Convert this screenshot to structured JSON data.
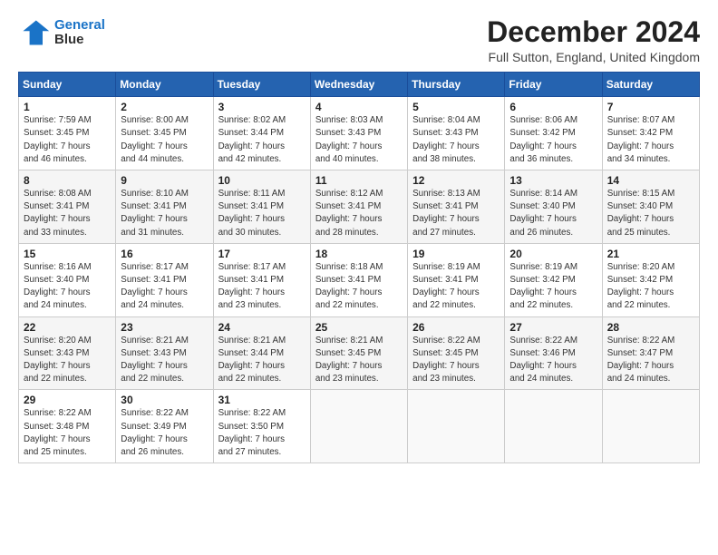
{
  "logo": {
    "line1": "General",
    "line2": "Blue"
  },
  "title": "December 2024",
  "subtitle": "Full Sutton, England, United Kingdom",
  "days_header": [
    "Sunday",
    "Monday",
    "Tuesday",
    "Wednesday",
    "Thursday",
    "Friday",
    "Saturday"
  ],
  "weeks": [
    [
      {
        "num": "1",
        "info": "Sunrise: 7:59 AM\nSunset: 3:45 PM\nDaylight: 7 hours\nand 46 minutes."
      },
      {
        "num": "2",
        "info": "Sunrise: 8:00 AM\nSunset: 3:45 PM\nDaylight: 7 hours\nand 44 minutes."
      },
      {
        "num": "3",
        "info": "Sunrise: 8:02 AM\nSunset: 3:44 PM\nDaylight: 7 hours\nand 42 minutes."
      },
      {
        "num": "4",
        "info": "Sunrise: 8:03 AM\nSunset: 3:43 PM\nDaylight: 7 hours\nand 40 minutes."
      },
      {
        "num": "5",
        "info": "Sunrise: 8:04 AM\nSunset: 3:43 PM\nDaylight: 7 hours\nand 38 minutes."
      },
      {
        "num": "6",
        "info": "Sunrise: 8:06 AM\nSunset: 3:42 PM\nDaylight: 7 hours\nand 36 minutes."
      },
      {
        "num": "7",
        "info": "Sunrise: 8:07 AM\nSunset: 3:42 PM\nDaylight: 7 hours\nand 34 minutes."
      }
    ],
    [
      {
        "num": "8",
        "info": "Sunrise: 8:08 AM\nSunset: 3:41 PM\nDaylight: 7 hours\nand 33 minutes."
      },
      {
        "num": "9",
        "info": "Sunrise: 8:10 AM\nSunset: 3:41 PM\nDaylight: 7 hours\nand 31 minutes."
      },
      {
        "num": "10",
        "info": "Sunrise: 8:11 AM\nSunset: 3:41 PM\nDaylight: 7 hours\nand 30 minutes."
      },
      {
        "num": "11",
        "info": "Sunrise: 8:12 AM\nSunset: 3:41 PM\nDaylight: 7 hours\nand 28 minutes."
      },
      {
        "num": "12",
        "info": "Sunrise: 8:13 AM\nSunset: 3:41 PM\nDaylight: 7 hours\nand 27 minutes."
      },
      {
        "num": "13",
        "info": "Sunrise: 8:14 AM\nSunset: 3:40 PM\nDaylight: 7 hours\nand 26 minutes."
      },
      {
        "num": "14",
        "info": "Sunrise: 8:15 AM\nSunset: 3:40 PM\nDaylight: 7 hours\nand 25 minutes."
      }
    ],
    [
      {
        "num": "15",
        "info": "Sunrise: 8:16 AM\nSunset: 3:40 PM\nDaylight: 7 hours\nand 24 minutes."
      },
      {
        "num": "16",
        "info": "Sunrise: 8:17 AM\nSunset: 3:41 PM\nDaylight: 7 hours\nand 24 minutes."
      },
      {
        "num": "17",
        "info": "Sunrise: 8:17 AM\nSunset: 3:41 PM\nDaylight: 7 hours\nand 23 minutes."
      },
      {
        "num": "18",
        "info": "Sunrise: 8:18 AM\nSunset: 3:41 PM\nDaylight: 7 hours\nand 22 minutes."
      },
      {
        "num": "19",
        "info": "Sunrise: 8:19 AM\nSunset: 3:41 PM\nDaylight: 7 hours\nand 22 minutes."
      },
      {
        "num": "20",
        "info": "Sunrise: 8:19 AM\nSunset: 3:42 PM\nDaylight: 7 hours\nand 22 minutes."
      },
      {
        "num": "21",
        "info": "Sunrise: 8:20 AM\nSunset: 3:42 PM\nDaylight: 7 hours\nand 22 minutes."
      }
    ],
    [
      {
        "num": "22",
        "info": "Sunrise: 8:20 AM\nSunset: 3:43 PM\nDaylight: 7 hours\nand 22 minutes."
      },
      {
        "num": "23",
        "info": "Sunrise: 8:21 AM\nSunset: 3:43 PM\nDaylight: 7 hours\nand 22 minutes."
      },
      {
        "num": "24",
        "info": "Sunrise: 8:21 AM\nSunset: 3:44 PM\nDaylight: 7 hours\nand 22 minutes."
      },
      {
        "num": "25",
        "info": "Sunrise: 8:21 AM\nSunset: 3:45 PM\nDaylight: 7 hours\nand 23 minutes."
      },
      {
        "num": "26",
        "info": "Sunrise: 8:22 AM\nSunset: 3:45 PM\nDaylight: 7 hours\nand 23 minutes."
      },
      {
        "num": "27",
        "info": "Sunrise: 8:22 AM\nSunset: 3:46 PM\nDaylight: 7 hours\nand 24 minutes."
      },
      {
        "num": "28",
        "info": "Sunrise: 8:22 AM\nSunset: 3:47 PM\nDaylight: 7 hours\nand 24 minutes."
      }
    ],
    [
      {
        "num": "29",
        "info": "Sunrise: 8:22 AM\nSunset: 3:48 PM\nDaylight: 7 hours\nand 25 minutes."
      },
      {
        "num": "30",
        "info": "Sunrise: 8:22 AM\nSunset: 3:49 PM\nDaylight: 7 hours\nand 26 minutes."
      },
      {
        "num": "31",
        "info": "Sunrise: 8:22 AM\nSunset: 3:50 PM\nDaylight: 7 hours\nand 27 minutes."
      },
      {
        "num": "",
        "info": ""
      },
      {
        "num": "",
        "info": ""
      },
      {
        "num": "",
        "info": ""
      },
      {
        "num": "",
        "info": ""
      }
    ]
  ]
}
